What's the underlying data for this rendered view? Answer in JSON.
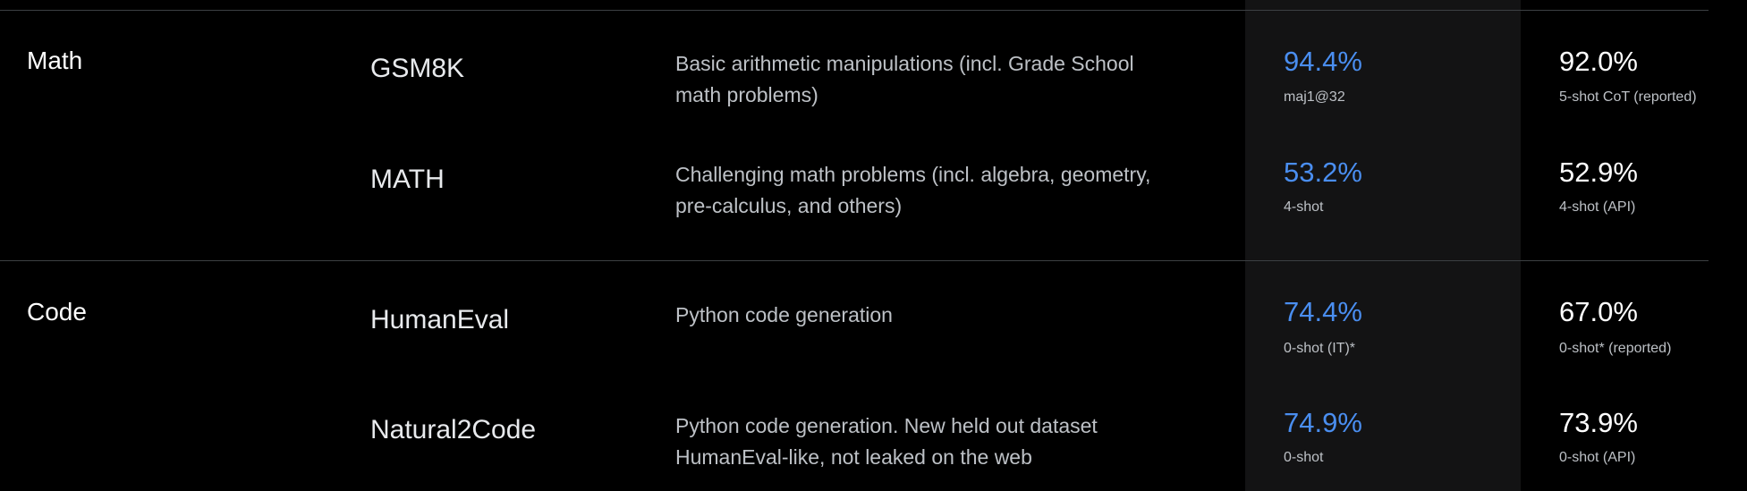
{
  "chart_data": {
    "type": "table",
    "rows": [
      {
        "section": "Math",
        "benchmark": "GSM8K",
        "description": "Basic arithmetic manipulations (incl. Grade School math problems)",
        "desc_lines": [
          "Basic arithmetic manipulations (incl. Grade School",
          "math problems)"
        ],
        "gemini_score": "94.4%",
        "gemini_note": "maj1@32",
        "gpt4_score": "92.0%",
        "gpt4_note": "5-shot CoT (reported)"
      },
      {
        "section": "",
        "benchmark": "MATH",
        "description": "Challenging math problems (incl. algebra, geometry, pre-calculus, and others)",
        "desc_lines": [
          "Challenging math problems (incl. algebra, geometry,",
          "pre-calculus, and others)"
        ],
        "gemini_score": "53.2%",
        "gemini_note": "4-shot",
        "gpt4_score": "52.9%",
        "gpt4_note": "4-shot (API)"
      },
      {
        "section": "Code",
        "benchmark": "HumanEval",
        "description": "Python code generation",
        "desc_lines": [
          "Python code generation"
        ],
        "gemini_score": "74.4%",
        "gemini_note": "0-shot (IT)*",
        "gpt4_score": "67.0%",
        "gpt4_note": "0-shot* (reported)"
      },
      {
        "section": "",
        "benchmark": "Natural2Code",
        "description": "Python code generation. New held out dataset HumanEval-like, not leaked on the web",
        "desc_lines": [
          "Python code generation. New held out dataset",
          "HumanEval-like, not leaked on the web"
        ],
        "gemini_score": "74.9%",
        "gemini_note": "0-shot",
        "gpt4_score": "73.9%",
        "gpt4_note": "0-shot (API)"
      }
    ],
    "values": {
      "gemini": [
        94.4,
        53.2,
        74.4,
        74.9
      ],
      "gpt4": [
        92.0,
        52.9,
        67.0,
        73.9
      ]
    }
  },
  "colors": {
    "background": "#000000",
    "highlight_column": "#131314",
    "gemini_score": "#4a8ef0",
    "gpt4_score": "#ffffff",
    "divider": "#3c4043"
  }
}
